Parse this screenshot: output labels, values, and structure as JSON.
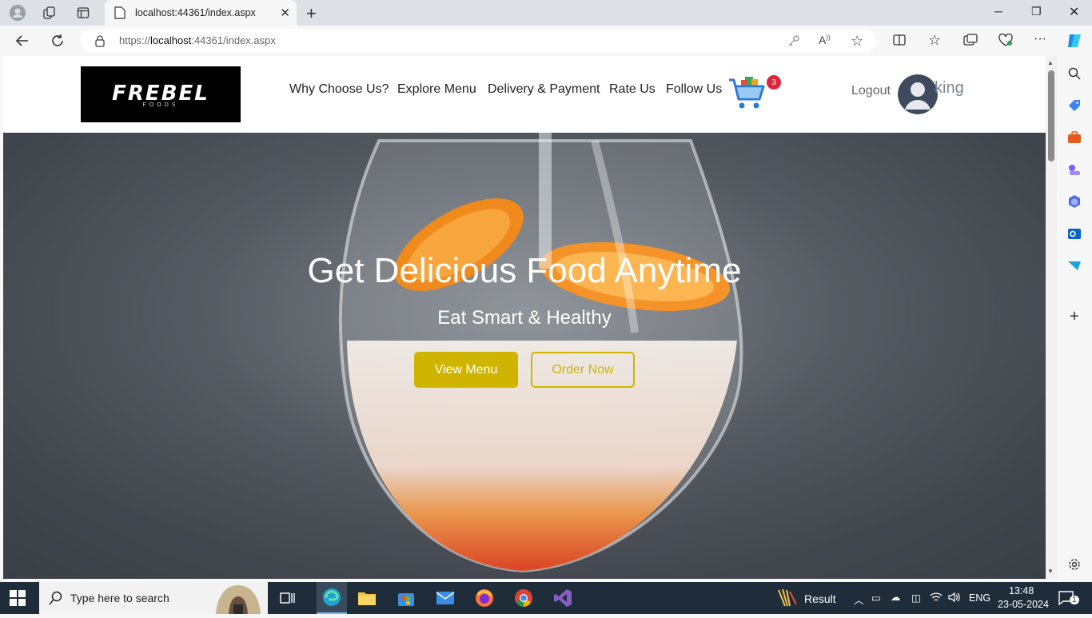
{
  "browser": {
    "tab_title": "localhost:44361/index.aspx",
    "url_prefix": "https://",
    "url_host": "localhost",
    "url_rest": ":44361/index.aspx"
  },
  "header": {
    "logo_text": "REBEL",
    "logo_first_letter": "F",
    "logo_subtext": "FOODS",
    "nav": [
      "Why Choose Us?",
      "Explore Menu",
      "Delivery & Payment",
      "Rate Us",
      "Follow Us"
    ],
    "cart_count": "3",
    "logout_label": "Logout",
    "username": "king"
  },
  "hero": {
    "title": "Get Delicious Food Anytime",
    "subtitle": "Eat Smart & Healthy",
    "primary_button": "View Menu",
    "secondary_button": "Order Now"
  },
  "taskbar": {
    "search_placeholder": "Type here to search",
    "result_label": "Result",
    "lang": "ENG",
    "time": "13:48",
    "date": "23-05-2024",
    "notifications": "1"
  },
  "colors": {
    "accent": "#cfb500",
    "badge": "#e0243a",
    "taskbar": "#1f2d3a"
  }
}
